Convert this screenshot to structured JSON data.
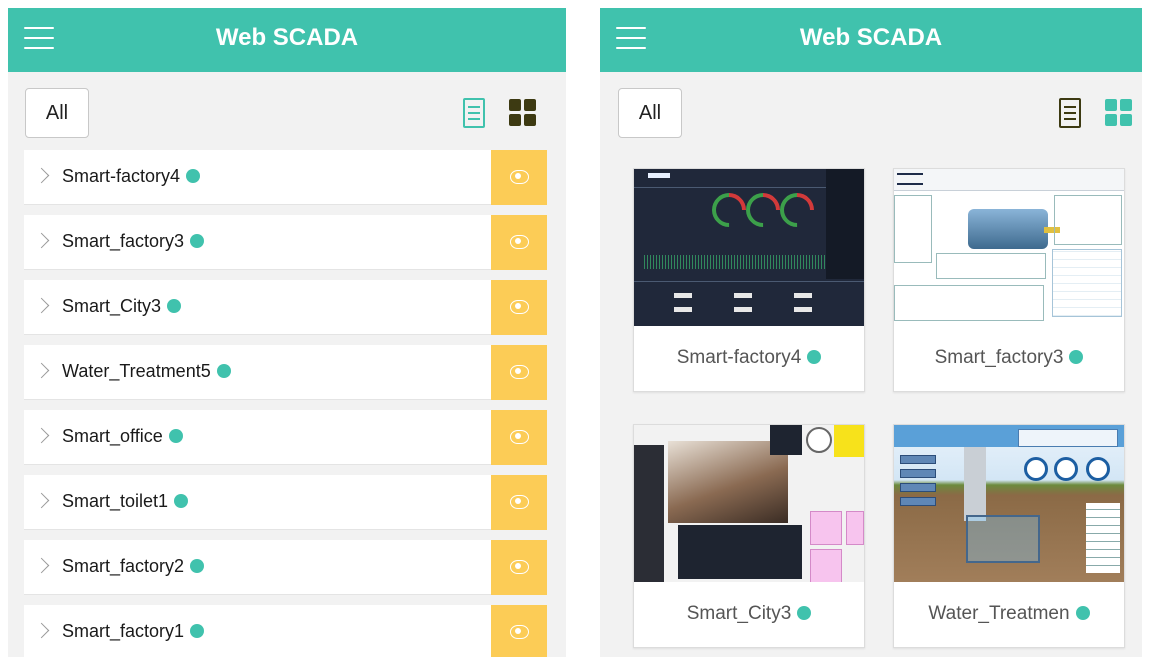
{
  "app": {
    "title": "Web SCADA",
    "accent_color": "#40c2ad",
    "action_color": "#fccc56",
    "status_color": "#40c2ad"
  },
  "left_panel": {
    "filter_label": "All",
    "active_view": "list",
    "items": [
      {
        "name": "Smart-factory4"
      },
      {
        "name": "Smart_factory3"
      },
      {
        "name": "Smart_City3"
      },
      {
        "name": "Water_Treatment5"
      },
      {
        "name": "Smart_office"
      },
      {
        "name": "Smart_toilet1"
      },
      {
        "name": "Smart_factory2"
      },
      {
        "name": "Smart_factory1"
      }
    ]
  },
  "right_panel": {
    "filter_label": "All",
    "active_view": "grid",
    "cards": [
      {
        "name": "Smart-factory4"
      },
      {
        "name": "Smart_factory3"
      },
      {
        "name": "Smart_City3"
      },
      {
        "name": "Water_Treatmen"
      }
    ]
  }
}
